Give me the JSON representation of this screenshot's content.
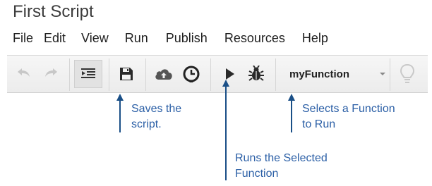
{
  "app": {
    "title": "First Script"
  },
  "menu": [
    "File",
    "Edit",
    "View",
    "Run",
    "Publish",
    "Resources",
    "Help"
  ],
  "toolbar": {
    "function_select_value": "myFunction",
    "icons": [
      "undo-icon",
      "redo-icon",
      "indent-icon",
      "save-icon",
      "cloud-upload-icon",
      "clock-icon",
      "play-icon",
      "bug-icon",
      "chevron-down-icon",
      "lightbulb-icon"
    ]
  },
  "annotations": {
    "save": {
      "line1": "Saves the",
      "line2": "script."
    },
    "function": {
      "line1": "Selects a Function",
      "line2": "to Run"
    },
    "run": {
      "line1": "Runs the Selected",
      "line2": "Function"
    }
  },
  "colors": {
    "accent": "#1a4f87",
    "callout_text": "#2b5fa6",
    "toolbar_bg": "#efefef"
  }
}
